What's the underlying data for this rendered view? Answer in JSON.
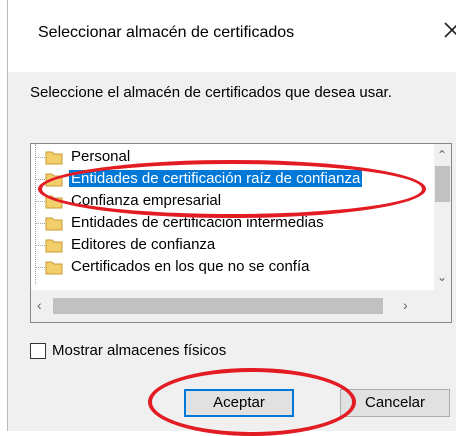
{
  "dialog": {
    "title": "Seleccionar almacén de certificados",
    "prompt": "Seleccione el almacén de certificados que desea usar."
  },
  "stores": [
    {
      "label": "Personal",
      "selected": false
    },
    {
      "label": "Entidades de certificación raíz de confianza",
      "selected": true
    },
    {
      "label": "Confianza empresarial",
      "selected": false
    },
    {
      "label": "Entidades de certificación intermedias",
      "selected": false
    },
    {
      "label": "Editores de confianza",
      "selected": false
    },
    {
      "label": "Certificados en los que no se confía",
      "selected": false
    }
  ],
  "options": {
    "show_physical_label": "Mostrar almacenes físicos",
    "show_physical_checked": false
  },
  "buttons": {
    "ok_label": "Aceptar",
    "cancel_label": "Cancelar"
  },
  "colors": {
    "selection": "#0078d7",
    "annotation": "#e31b23",
    "dialog_bg": "#f0f0f0"
  }
}
